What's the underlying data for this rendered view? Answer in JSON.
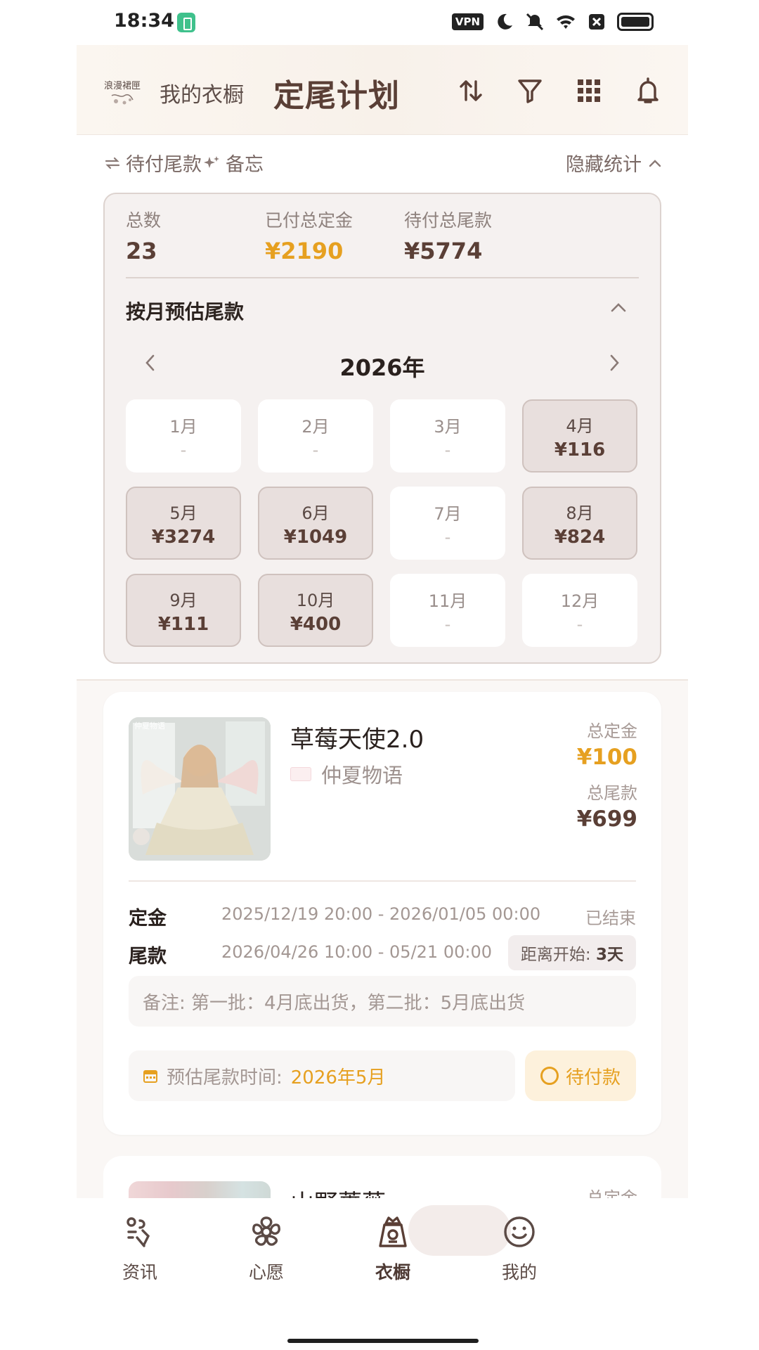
{
  "status": {
    "time": "18:34",
    "vpn": "VPN"
  },
  "appbar": {
    "logo_text": "浪漫裙匣",
    "subtitle": "我的衣橱",
    "title": "定尾计划",
    "actions": [
      "sort-icon",
      "filter-icon",
      "grid-icon",
      "bell-icon"
    ]
  },
  "toolbar": {
    "pending_label": "待付尾款",
    "memo_label": "备忘",
    "hide_stats_label": "隐藏统计"
  },
  "stats": {
    "total_label": "总数",
    "total_value": "23",
    "paid_deposit_label": "已付总定金",
    "paid_deposit_value": "¥2190",
    "pending_balance_label": "待付总尾款",
    "pending_balance_value": "¥5774",
    "monthly_title": "按月预估尾款",
    "year": "2026年",
    "months": [
      {
        "month": "1月",
        "amount": "-",
        "active": false
      },
      {
        "month": "2月",
        "amount": "-",
        "active": false
      },
      {
        "month": "3月",
        "amount": "-",
        "active": false
      },
      {
        "month": "4月",
        "amount": "¥116",
        "active": true
      },
      {
        "month": "5月",
        "amount": "¥3274",
        "active": true
      },
      {
        "month": "6月",
        "amount": "¥1049",
        "active": true
      },
      {
        "month": "7月",
        "amount": "-",
        "active": false
      },
      {
        "month": "8月",
        "amount": "¥824",
        "active": true
      },
      {
        "month": "9月",
        "amount": "¥111",
        "active": true
      },
      {
        "month": "10月",
        "amount": "¥400",
        "active": true
      },
      {
        "month": "11月",
        "amount": "-",
        "active": false
      },
      {
        "month": "12月",
        "amount": "-",
        "active": false
      }
    ]
  },
  "items": [
    {
      "thumb_watermark": "仲夏物语",
      "name": "草莓天使2.0",
      "brand": "仲夏物语",
      "deposit_label": "总定金",
      "deposit_value": "¥100",
      "balance_label": "总尾款",
      "balance_value": "¥699",
      "deposit_period_label": "定金",
      "deposit_period": "2025/12/19 20:00 - 2026/01/05 00:00",
      "deposit_status": "已结束",
      "balance_period_label": "尾款",
      "balance_period": "2026/04/26 10:00 - 05/21 00:00",
      "countdown_label": "距离开始:",
      "countdown_value": "3天",
      "note": "备注: 第一批：4月底出货，第二批：5月底出货",
      "est_label": "预估尾款时间:",
      "est_value": "2026年5月",
      "pay_status": "待付款"
    },
    {
      "name": "山野蔷薇",
      "deposit_label": "总定金"
    }
  ],
  "nav": {
    "items": [
      {
        "label": "资讯",
        "icon": "news-icon"
      },
      {
        "label": "心愿",
        "icon": "flower-icon"
      },
      {
        "label": "衣橱",
        "icon": "wardrobe-icon"
      },
      {
        "label": "我的",
        "icon": "smile-icon"
      }
    ],
    "active_index": 2
  },
  "colors": {
    "accent_orange": "#e6a020",
    "primary_brown": "#5a3f36",
    "active_month_bg": "#e8dfdd",
    "pay_button_bg": "#fdf1dc"
  }
}
